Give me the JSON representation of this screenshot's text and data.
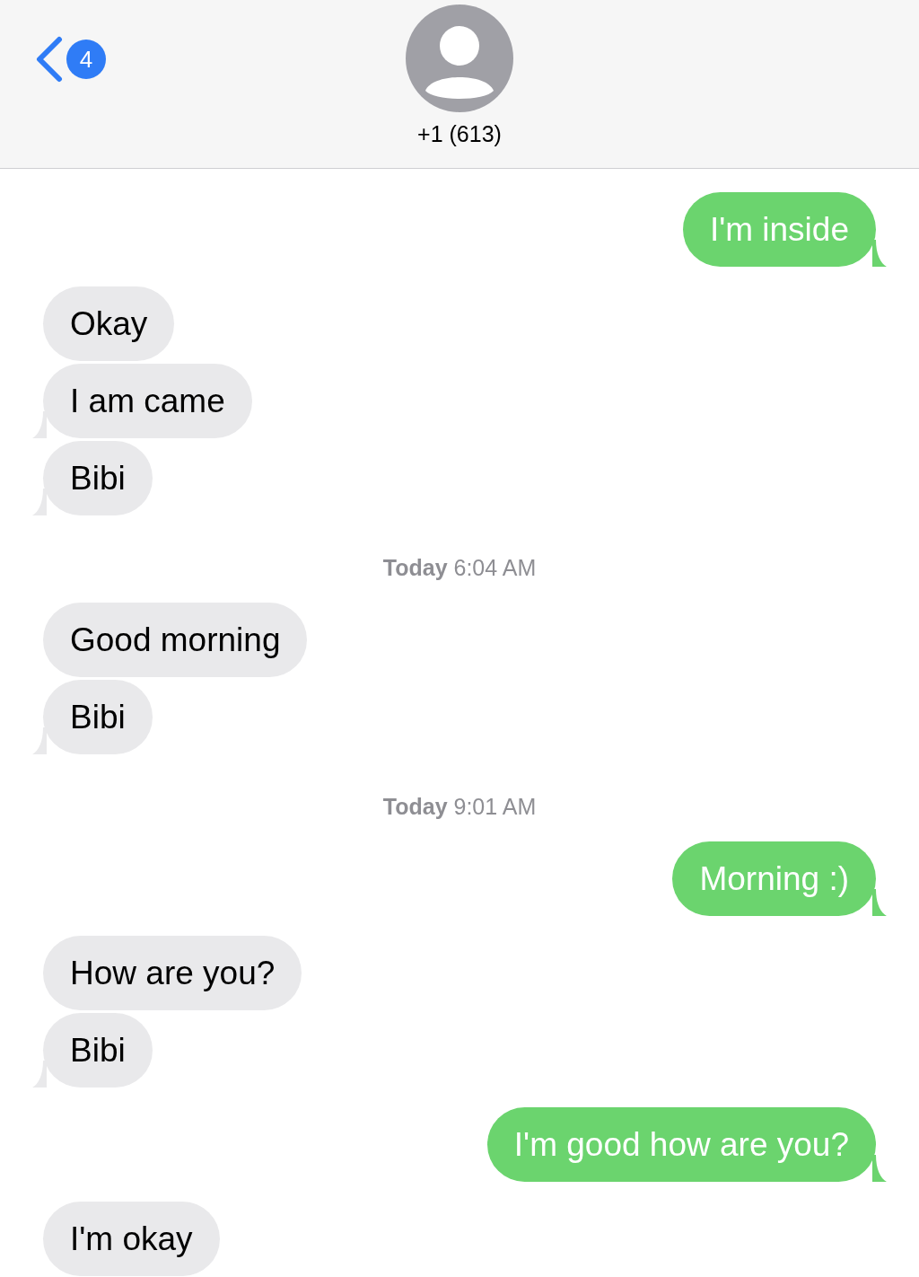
{
  "header": {
    "back_badge": "4",
    "contact": "+1 (613)"
  },
  "items": [
    {
      "kind": "message",
      "outgoing": true,
      "text": "I'm inside",
      "tail": true
    },
    {
      "kind": "message",
      "outgoing": false,
      "text": "Okay",
      "tail": false
    },
    {
      "kind": "message",
      "outgoing": false,
      "text": "I am came",
      "tail": true
    },
    {
      "kind": "message",
      "outgoing": false,
      "text": "Bibi",
      "tail": true
    },
    {
      "kind": "timestamp",
      "text": "**Today** 6:04 AM"
    },
    {
      "kind": "message",
      "outgoing": false,
      "text": "Good morning",
      "tail": false
    },
    {
      "kind": "message",
      "outgoing": false,
      "text": "Bibi",
      "tail": true
    },
    {
      "kind": "timestamp",
      "text": "**Today** 9:01 AM"
    },
    {
      "kind": "message",
      "outgoing": true,
      "text": "Morning :)",
      "tail": true
    },
    {
      "kind": "message",
      "outgoing": false,
      "text": "How are you?",
      "tail": false
    },
    {
      "kind": "message",
      "outgoing": false,
      "text": "Bibi",
      "tail": true
    },
    {
      "kind": "message",
      "outgoing": true,
      "text": "I'm good how are you?",
      "tail": true
    },
    {
      "kind": "message",
      "outgoing": false,
      "text": "I'm okay",
      "tail": false
    }
  ]
}
